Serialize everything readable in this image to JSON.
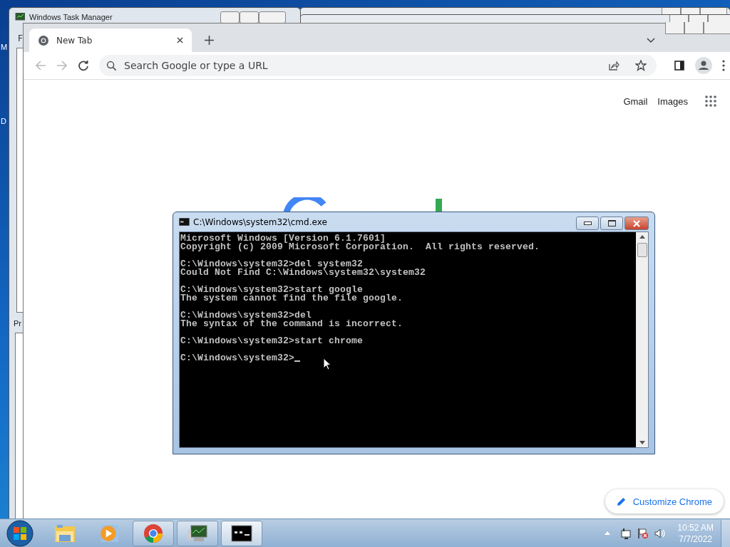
{
  "desktop": {
    "icon_labels": [
      "M",
      "D"
    ]
  },
  "task_manager": {
    "title": "Windows Task Manager",
    "menu_fragment": "F",
    "tab_fragment": "Pr"
  },
  "browser": {
    "tab": {
      "title": "New Tab",
      "selected": true
    },
    "omnibox": {
      "placeholder": "Search Google or type a URL"
    },
    "header_links": [
      "Gmail",
      "Images"
    ],
    "customize_button": "Customize Chrome"
  },
  "console": {
    "title": "C:\\Windows\\system32\\cmd.exe",
    "blocks": [
      [
        "Microsoft Windows [Version 6.1.7601]",
        "Copyright (c) 2009 Microsoft Corporation.  All rights reserved."
      ],
      [
        "C:\\Windows\\system32>del system32",
        "Could Not Find C:\\Windows\\system32\\system32"
      ],
      [
        "C:\\Windows\\system32>start google",
        "The system cannot find the file google."
      ],
      [
        "C:\\Windows\\system32>del",
        "The syntax of the command is incorrect."
      ],
      [
        "C:\\Windows\\system32>start chrome"
      ],
      [
        "C:\\Windows\\system32>"
      ]
    ]
  },
  "taskbar": {
    "buttons": [
      {
        "kind": "explorer",
        "running": false,
        "selected": false
      },
      {
        "kind": "media",
        "running": false,
        "selected": false
      },
      {
        "kind": "chrome",
        "running": true,
        "selected": false
      },
      {
        "kind": "taskmgr",
        "running": true,
        "selected": false
      },
      {
        "kind": "cmd",
        "running": true,
        "selected": true
      }
    ],
    "clock": {
      "time": "10:52 AM",
      "date": "7/7/2022"
    }
  }
}
